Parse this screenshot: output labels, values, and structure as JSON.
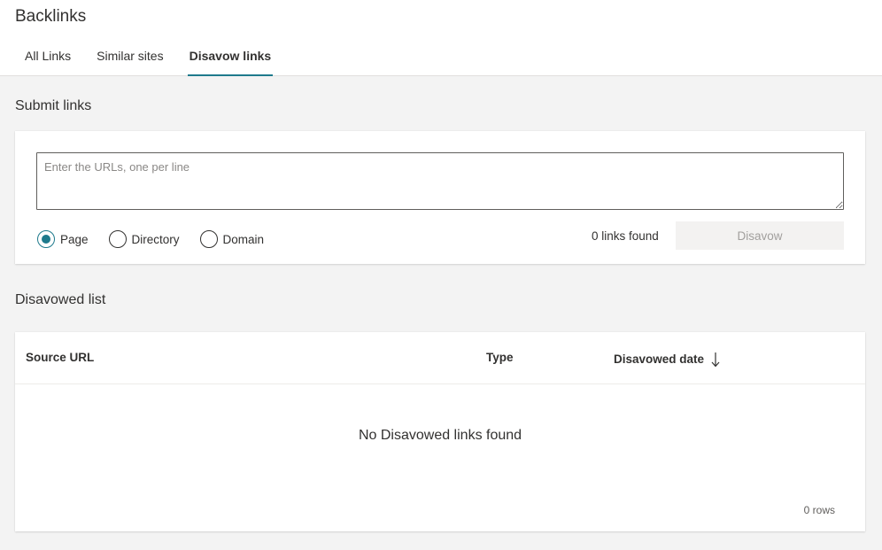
{
  "header": {
    "title": "Backlinks",
    "tabs": [
      {
        "label": "All Links",
        "active": false
      },
      {
        "label": "Similar sites",
        "active": false
      },
      {
        "label": "Disavow links",
        "active": true
      }
    ]
  },
  "submit": {
    "section_title": "Submit links",
    "input_placeholder": "Enter the URLs, one per line",
    "input_value": "",
    "radio_options": [
      {
        "label": "Page",
        "checked": true
      },
      {
        "label": "Directory",
        "checked": false
      },
      {
        "label": "Domain",
        "checked": false
      }
    ],
    "links_found": "0 links found",
    "disavow_label": "Disavow"
  },
  "disavowed": {
    "section_title": "Disavowed list",
    "columns": [
      "Source URL",
      "Type",
      "Disavowed date"
    ],
    "sort_icon": "arrow-down-icon",
    "empty_message": "No Disavowed links found",
    "row_count": "0 rows"
  },
  "colors": {
    "accent": "#1e7a8c",
    "background": "#f3f3f3",
    "card": "#ffffff"
  }
}
